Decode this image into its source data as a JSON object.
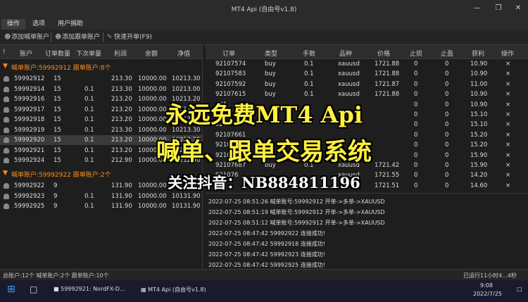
{
  "window": {
    "title": "MT4 Api (自由号v1.8)"
  },
  "menu": [
    {
      "label": "操作",
      "active": true
    },
    {
      "label": "选项"
    },
    {
      "label": "用户捐助"
    }
  ],
  "toolbar": {
    "add_caller": "添加喊单账户",
    "add_follower": "添加跟单账户",
    "quick_open": "快速开单(F9)"
  },
  "accounts": {
    "headers": [
      "!",
      "账户",
      "订单数量",
      "下次单量",
      "利润",
      "余额",
      "净值"
    ],
    "group1": {
      "label": "喊单账户:59992912 跟单账户:8个",
      "rows": [
        {
          "account": "59992912",
          "orders": "15",
          "next": "",
          "profit": "213.30",
          "balance": "10000.00",
          "equity": "10213.30"
        },
        {
          "account": "59992914",
          "orders": "15",
          "next": "0.1",
          "profit": "213.30",
          "balance": "10000.00",
          "equity": "10213.00"
        },
        {
          "account": "59992916",
          "orders": "15",
          "next": "0.1",
          "profit": "213.20",
          "balance": "10000.00",
          "equity": "10213.20"
        },
        {
          "account": "59992917",
          "orders": "15",
          "next": "0.1",
          "profit": "213.20",
          "balance": "10000.00",
          "equity": "10213.20"
        },
        {
          "account": "59992918",
          "orders": "15",
          "next": "0.1",
          "profit": "213.20",
          "balance": "10000.00",
          "equity": "10213.20"
        },
        {
          "account": "59992919",
          "orders": "15",
          "next": "0.1",
          "profit": "213.30",
          "balance": "10000.00",
          "equity": "10213.30"
        },
        {
          "account": "59992920",
          "orders": "15",
          "next": "0.1",
          "profit": "213.20",
          "balance": "10000.00",
          "equity": "10213.20"
        },
        {
          "account": "59992921",
          "orders": "15",
          "next": "0.1",
          "profit": "213.20",
          "balance": "10000.00",
          "equity": "10213.20"
        },
        {
          "account": "59992924",
          "orders": "15",
          "next": "0.1",
          "profit": "212.90",
          "balance": "10000.00",
          "equity": "10212.90"
        }
      ]
    },
    "group2": {
      "label": "喊单账户:59992922 跟单账户:2个",
      "rows": [
        {
          "account": "59992922",
          "orders": "9",
          "next": "",
          "profit": "131.90",
          "balance": "10000.00",
          "equity": "10131.90"
        },
        {
          "account": "59992923",
          "orders": "9",
          "next": "0.1",
          "profit": "131.90",
          "balance": "10000.00",
          "equity": "10131.90"
        },
        {
          "account": "59992925",
          "orders": "9",
          "next": "0.1",
          "profit": "131.90",
          "balance": "10000.00",
          "equity": "10131.90"
        }
      ]
    }
  },
  "orders": {
    "headers": [
      "订单",
      "类型",
      "手数",
      "品种",
      "价格",
      "止损",
      "止盈",
      "获利",
      "操作"
    ],
    "rows": [
      {
        "id": "92107574",
        "type": "buy",
        "lots": "0.1",
        "symbol": "xauusd",
        "price": "1721.88",
        "sl": "0",
        "tp": "0",
        "profit": "10.90",
        "op": "×"
      },
      {
        "id": "92107583",
        "type": "buy",
        "lots": "0.1",
        "symbol": "xauusd",
        "price": "1721.88",
        "sl": "0",
        "tp": "0",
        "profit": "10.90",
        "op": "×"
      },
      {
        "id": "92107592",
        "type": "buy",
        "lots": "0.1",
        "symbol": "xauusd",
        "price": "1721.87",
        "sl": "0",
        "tp": "0",
        "profit": "11.00",
        "op": "×"
      },
      {
        "id": "92107615",
        "type": "buy",
        "lots": "0.1",
        "symbol": "xauusd",
        "price": "1721.88",
        "sl": "0",
        "tp": "0",
        "profit": "10.90",
        "op": "×"
      },
      {
        "id": "921",
        "type": "",
        "lots": "",
        "symbol": "",
        "price": "",
        "sl": "0",
        "tp": "0",
        "profit": "10.90",
        "op": "×"
      },
      {
        "id": "",
        "type": "",
        "lots": "",
        "symbol": "",
        "price": "",
        "sl": "0",
        "tp": "0",
        "profit": "15.10",
        "op": "×"
      },
      {
        "id": "921",
        "type": "",
        "lots": "",
        "symbol": "",
        "price": "",
        "sl": "0",
        "tp": "0",
        "profit": "15.10",
        "op": "×"
      },
      {
        "id": "92107661",
        "type": "",
        "lots": "",
        "symbol": "",
        "price": "",
        "sl": "0",
        "tp": "0",
        "profit": "15.20",
        "op": "×"
      },
      {
        "id": "92107669",
        "type": "",
        "lots": "",
        "symbol": "",
        "price": "",
        "sl": "0",
        "tp": "0",
        "profit": "15.20",
        "op": "×"
      },
      {
        "id": "9210767",
        "type": "",
        "lots": "",
        "symbol": "",
        "price": "",
        "sl": "0",
        "tp": "0",
        "profit": "15.90",
        "op": "×"
      },
      {
        "id": "92107687",
        "type": "buy",
        "lots": "0.1",
        "symbol": "xauusd",
        "price": "1721.42",
        "sl": "0",
        "tp": "0",
        "profit": "15.90",
        "op": "×"
      },
      {
        "id": "921076",
        "type": "",
        "lots": "",
        "symbol": "xauusd",
        "price": "1721.55",
        "sl": "0",
        "tp": "0",
        "profit": "14.20",
        "op": "×"
      },
      {
        "id": "",
        "type": "",
        "lots": "",
        "symbol": "",
        "price": "1721.51",
        "sl": "0",
        "tp": "0",
        "profit": "14.60",
        "op": "×"
      }
    ]
  },
  "log": [
    "2022-07-25 08:51:26 喊单账号:59992912 开单->多单->XAUUSD",
    "2022-07-25 08:51:19 喊单账号:59992912 开单->多单->XAUUSD",
    "2022-07-25 08:51:12 喊单账号:59992912 开单->多单->XAUUSD",
    "2022-07-25 08:47:42 59992922 连接成功!",
    "2022-07-25 08:47:42 59992918 连接成功!",
    "2022-07-25 08:47:42 59992923 连接成功!",
    "2022-07-25 08:47:42 59992925 连接成功!"
  ],
  "status": {
    "left": "总账户:12个 喊单账户:2个 跟单账户:10个",
    "right": "已运行11小时4...4秒"
  },
  "taskbar": {
    "app1": "59992921: NordFX-D...",
    "app2": "MT4 Api (自由号v1.8)",
    "time": "9:08",
    "date": "2022/7/25"
  },
  "overlay": {
    "line1": "永远免费MT4 Api",
    "line2": "喊单、跟单交易系统",
    "line3": "关注抖音：NB884811196"
  }
}
